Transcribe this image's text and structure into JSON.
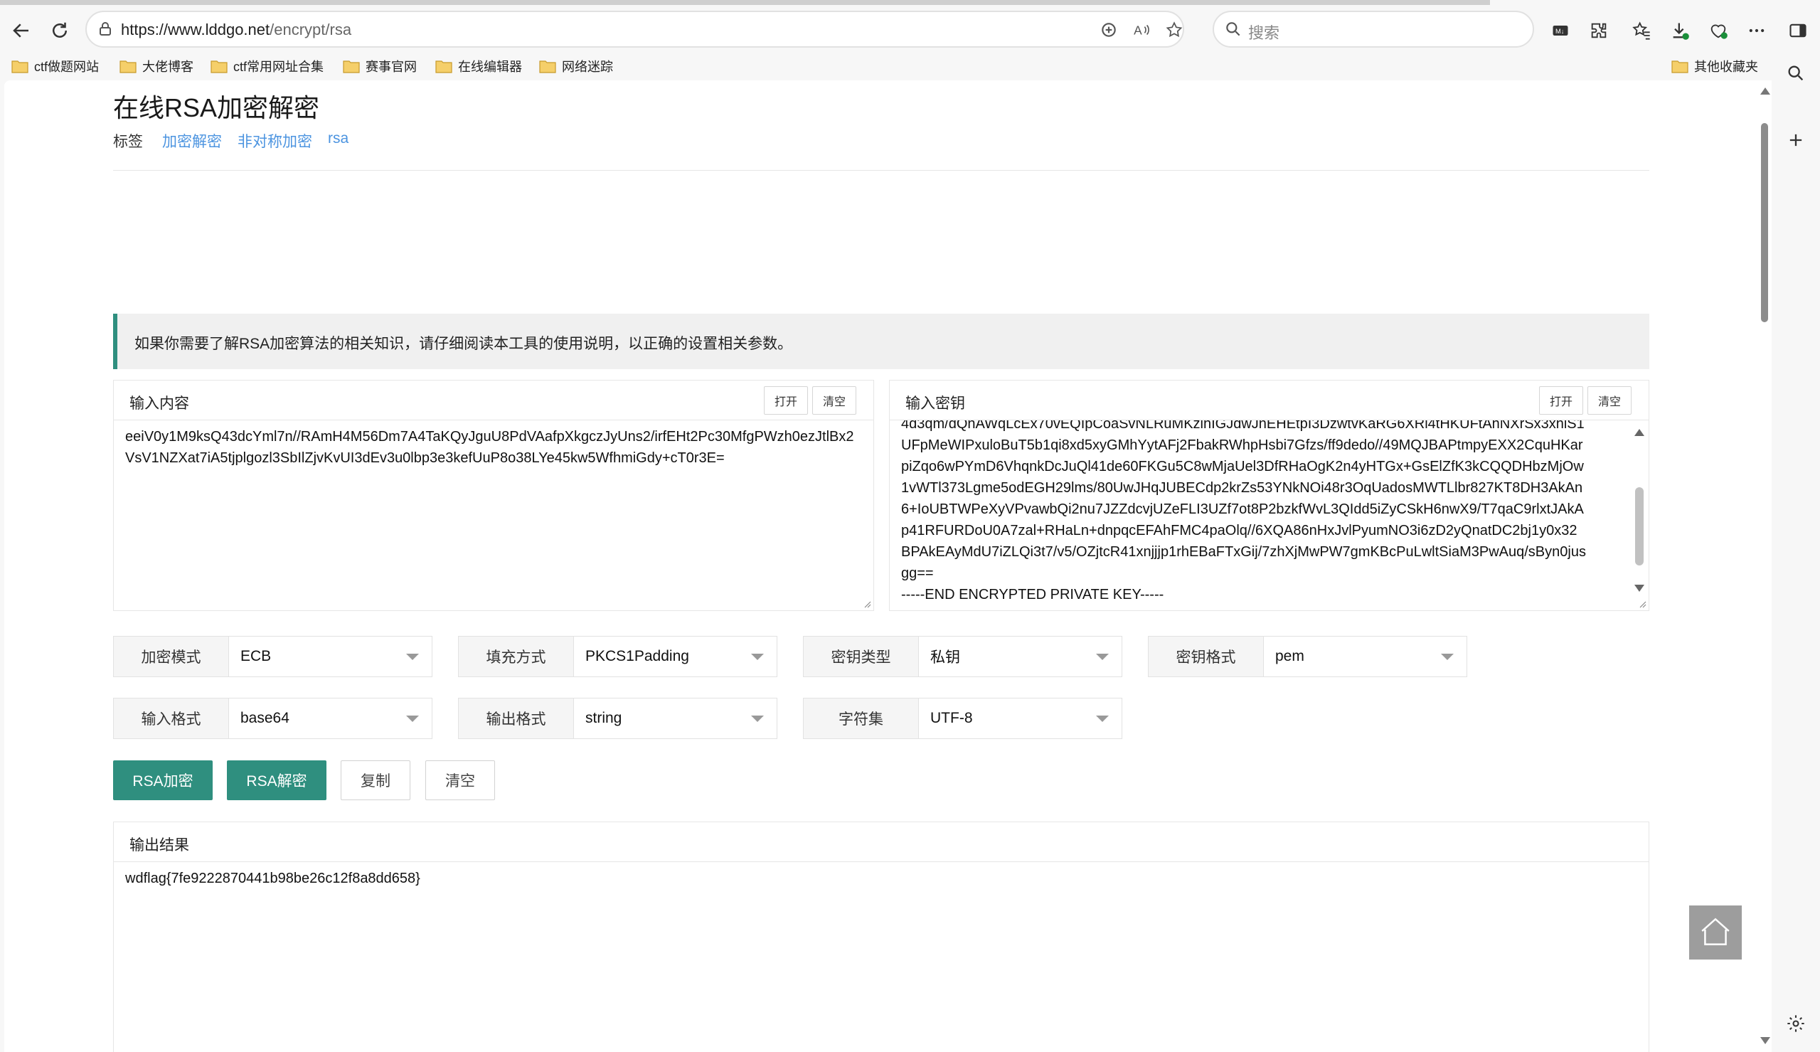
{
  "browser": {
    "url_host": "https://www.lddgo.net",
    "url_path": "/encrypt/rsa",
    "search_placeholder": "搜索",
    "bookmarks": [
      "ctf做题网站",
      "大佬博客",
      "ctf常用网址合集",
      "赛事官网",
      "在线编辑器",
      "网络迷踪"
    ],
    "other_bookmarks": "其他收藏夹"
  },
  "page": {
    "title": "在线RSA加密解密",
    "tag_label": "标签",
    "tags": [
      "加密解密",
      "非对称加密",
      "rsa"
    ],
    "notice": "如果你需要了解RSA加密算法的相关知识，请仔细阅读本工具的使用说明，以正确的设置相关参数。"
  },
  "input_panel": {
    "title": "输入内容",
    "open_label": "打开",
    "clear_label": "清空",
    "content": "eeiV0y1M9ksQ43dcYml7n//RAmH4M56Dm7A4TaKQyJguU8PdVAafpXkgczJyUns2/irfEHt2Pc30MfgPWzh0ezJtlBx2VsV1NZXat7iA5tjplgozl3SbIlZjvKvUI3dEv3u0lbp3e3kefUuP8o38LYe45kw5WfhmiGdy+cT0r3E="
  },
  "key_panel": {
    "title": "输入密钥",
    "open_label": "打开",
    "clear_label": "清空",
    "lines": [
      "4d3qm/dQnAWqLcEx70vEQIpCoaSvNLRuMKzlhIGJdwJnEHEtpI3DzwtvKaRG6XRl4tHKUFtAhNXrSx3xhiS1",
      "UFpMeWIPxuloBuT5b1qi8xd5xyGMhYytAFj2FbakRWhpHsbi7Gfzs/ff9dedo//49MQJBAPtmpyEXX2CquHKar",
      "piZqo6wPYmD6VhqnkDcJuQl41de60FKGu5C8wMjaUel3DfRHaOgK2n4yHTGx+GsElZfK3kCQQDHbzMjOw",
      "1vWTl373Lgme5odEGH29lms/80UwJHqJUBECdp2krZs53YNkNOi48r3OqUadosMWTLlbr827KT8DH3AkAn",
      "6+IoUBTWPeXyVPvawbQi2nu7JZZdcvjUZeFLI3UZf7ot8P2bzkfWvL3QIdd5iZyCSkH6nwX9/T7qaC9rlxtJAkA",
      "p41RFURDoU0A7zal+RHaLn+dnpqcEFAhFMC4paOlq//6XQA86nHxJvlPyumNO3i6zD2yQnatDC2bj1y0x32",
      "BPAkEAyMdU7iZLQi3t7/v5/OZjtcR41xnjjjp1rhEBaFTxGij/7zhXjMwPW7gmKBcPuLwltSiaM3PwAuq/sByn0jus",
      "gg==",
      "-----END ENCRYPTED PRIVATE KEY-----"
    ]
  },
  "options": {
    "mode": {
      "label": "加密模式",
      "value": "ECB"
    },
    "padding": {
      "label": "填充方式",
      "value": "PKCS1Padding"
    },
    "key_type": {
      "label": "密钥类型",
      "value": "私钥"
    },
    "key_format": {
      "label": "密钥格式",
      "value": "pem"
    },
    "input_format": {
      "label": "输入格式",
      "value": "base64"
    },
    "output_format": {
      "label": "输出格式",
      "value": "string"
    },
    "charset": {
      "label": "字符集",
      "value": "UTF-8"
    }
  },
  "actions": {
    "encrypt": "RSA加密",
    "decrypt": "RSA解密",
    "copy": "复制",
    "clear": "清空"
  },
  "output_panel": {
    "title": "输出结果",
    "content": "wdflag{7fe9222870441b98be26c12f8a8dd658}"
  },
  "colors": {
    "accent": "#2f8f7f",
    "link": "#4c94e0"
  }
}
